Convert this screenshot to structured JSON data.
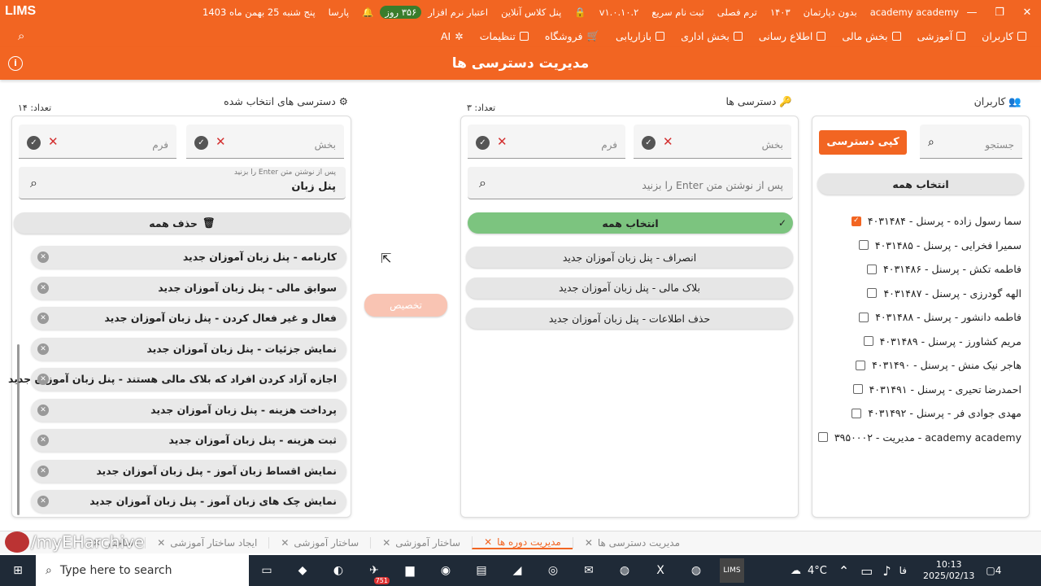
{
  "top_bar": {
    "app": "LIMS",
    "items": [
      "academy academy",
      "بدون دپارتمان",
      "۱۴۰۳",
      "ترم فصلی",
      "ثبت نام سریع",
      "v۱.۰.۱۰.۲",
      "پنل کلاس آنلاین",
      "اعتبار نرم افزار",
      "۳۵۶ روز",
      "پارسا",
      "پنج شنبه 25 بهمن ماه 1403"
    ]
  },
  "menu": {
    "items": [
      "کاربران",
      "آموزشی",
      "بخش مالی",
      "اطلاع رسانی",
      "بخش اداری",
      "بازاریابی",
      "فروشگاه",
      "تنظیمات",
      "AI"
    ]
  },
  "page_title": "مدیریت دسترسی ها",
  "users": {
    "title": "کاربران",
    "search_placeholder": "جستجو",
    "copy_button": "کپی دسترسی",
    "select_all": "انتخاب همه",
    "list": [
      "سما رسول زاده - پرسنل - ۴۰۳۱۴۸۴",
      "سمیرا فخرایی - پرسنل - ۴۰۳۱۴۸۵",
      "فاطمه تکش - پرسنل - ۴۰۳۱۴۸۶",
      "الهه گودرزی - پرسنل - ۴۰۳۱۴۸۷",
      "فاطمه دانشور - پرسنل - ۴۰۳۱۴۸۸",
      "مریم کشاورز - پرسنل - ۴۰۳۱۴۸۹",
      "هاجر نیک منش - پرسنل - ۴۰۳۱۴۹۰",
      "احمدرضا تحیری - پرسنل - ۴۰۳۱۴۹۱",
      "مهدی جوادی فر - پرسنل - ۴۰۳۱۴۹۲",
      "academy academy - مدیریت - ۳۹۵۰۰۰۲"
    ]
  },
  "access": {
    "title": "دسترسی ها",
    "count": "تعداد: ۳",
    "section_ph": "بخش",
    "form_ph": "فرم",
    "search_hint": "پس از نوشتن متن Enter را بزنید",
    "select_all": "انتخاب همه",
    "items": [
      "انصراف - پنل زبان آموزان جدید",
      "بلاک مالی - پنل زبان آموزان جدید",
      "حذف اطلاعات - پنل زبان آموزان جدید"
    ]
  },
  "assign_button": "تخصیص",
  "selected": {
    "title": "دسترسی های انتخاب شده",
    "count": "تعداد: ۱۴",
    "section_ph": "بخش",
    "form_ph": "فرم",
    "search_hint": "پس از نوشتن متن Enter را بزنید",
    "search_value": "پنل زبان",
    "delete_all": "حذف همه",
    "items": [
      "کارنامه - پنل زبان آموزان جدید",
      "سوابق مالی - پنل زبان آموزان جدید",
      "فعال و غیر فعال کردن - پنل زبان آموزان جدید",
      "نمایش جزئیات - پنل زبان آموزان جدید",
      "اجازه آزاد کردن افراد که بلاک مالی هستند - پنل زبان آموزان جدید",
      "پرداخت هزینه - پنل زبان آموزان جدید",
      "ثبت هزینه - پنل زبان آموزان جدید",
      "نمایش اقساط زبان آموز - پنل زبان آموزان جدید",
      "نمایش چک های زبان آموز - پنل زبان آموزان جدید"
    ]
  },
  "bottom_tabs": [
    "مدیریت دسترسی ها",
    "مدیریت دوره ها",
    "ساختار آموزشی",
    "ساختار آموزشی",
    "ایجاد ساختار آموزشی",
    "ساختار"
  ],
  "watermark": "/myEHarchive",
  "taskbar": {
    "search": "Type here to search",
    "temp": "4°C",
    "time": "10:13",
    "date": "2025/02/13",
    "lang": "فا",
    "badge": "751",
    "notif": "4"
  },
  "colors": {
    "accent": "#f26522",
    "green": "#7cc47f"
  }
}
